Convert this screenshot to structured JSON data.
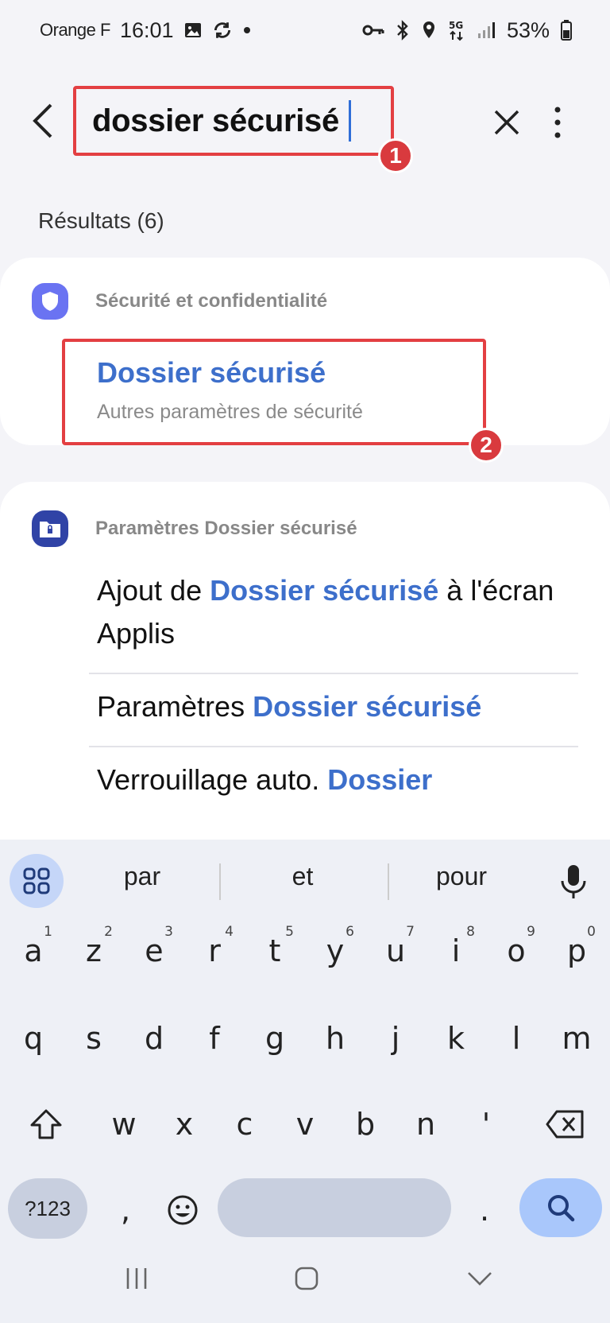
{
  "status_bar": {
    "carrier": "Orange F",
    "time": "16:01",
    "network": "5G",
    "battery": "53%",
    "icons": [
      "image-icon",
      "sync-icon",
      "dot-icon",
      "key-icon",
      "bluetooth-icon",
      "location-icon",
      "5g-icon",
      "signal-icon",
      "battery-icon"
    ]
  },
  "search": {
    "query": "dossier sécurisé",
    "back_icon": "chevron-left-icon",
    "clear_icon": "close-icon",
    "more_icon": "more-vertical-icon",
    "annotation_1": "1"
  },
  "results": {
    "label": "Résultats (6)"
  },
  "card_security": {
    "category": "Sécurité et confidentialité",
    "icon": "shield-icon",
    "icon_color": "#6a73f2",
    "item_title": "Dossier sécurisé",
    "item_subtitle": "Autres paramètres de sécurité",
    "annotation_2": "2"
  },
  "card_secure_folder": {
    "category": "Paramètres Dossier sécurisé",
    "icon": "secure-folder-icon",
    "icon_color": "#3043a6",
    "items": [
      {
        "pre": "Ajout de ",
        "hl": "Dossier sécurisé",
        "post": " à l'écran Applis"
      },
      {
        "pre": "Paramètres ",
        "hl": "Dossier sécurisé",
        "post": ""
      },
      {
        "pre": "Verrouillage auto. ",
        "hl": "Dossier",
        "post": ""
      }
    ]
  },
  "keyboard": {
    "suggestions": [
      "par",
      "et",
      "pour"
    ],
    "row1": [
      {
        "k": "a",
        "n": "1"
      },
      {
        "k": "z",
        "n": "2"
      },
      {
        "k": "e",
        "n": "3"
      },
      {
        "k": "r",
        "n": "4"
      },
      {
        "k": "t",
        "n": "5"
      },
      {
        "k": "y",
        "n": "6"
      },
      {
        "k": "u",
        "n": "7"
      },
      {
        "k": "i",
        "n": "8"
      },
      {
        "k": "o",
        "n": "9"
      },
      {
        "k": "p",
        "n": "0"
      }
    ],
    "row2": [
      "q",
      "s",
      "d",
      "f",
      "g",
      "h",
      "j",
      "k",
      "l",
      "m"
    ],
    "row3": [
      "w",
      "x",
      "c",
      "v",
      "b",
      "n",
      "'"
    ],
    "row4": {
      "sym": "?123",
      "comma": ",",
      "period": "."
    },
    "accent_color": "#a9c7fb"
  },
  "nav_bar": {
    "icons": [
      "recents-icon",
      "home-icon",
      "back-down-icon"
    ]
  }
}
